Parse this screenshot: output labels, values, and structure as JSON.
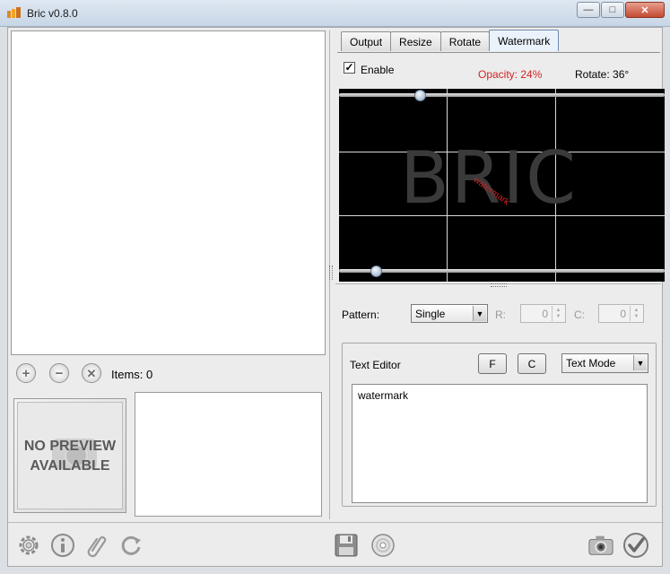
{
  "window": {
    "title": "Bric v0.8.0",
    "minimize_glyph": "—",
    "maximize_glyph": "□",
    "close_glyph": "✕"
  },
  "left": {
    "items_label": "Items: 0",
    "add_icon": "plus-circle-icon",
    "remove_icon": "minus-circle-icon",
    "clear_icon": "x-circle-icon",
    "preview_placeholder_line1": "NO PREVIEW",
    "preview_placeholder_line2": "AVAILABLE"
  },
  "tabs": [
    {
      "label": "Output",
      "active": false
    },
    {
      "label": "Resize",
      "active": false
    },
    {
      "label": "Rotate",
      "active": false
    },
    {
      "label": "Watermark",
      "active": true
    }
  ],
  "watermark": {
    "enable_label": "Enable",
    "enable_checked": true,
    "opacity_label": "Opacity: 24%",
    "opacity_percent": 24,
    "rotate_label": "Rotate: 36°",
    "rotate_degrees": 36,
    "preview_text_large": "BRIC",
    "preview_text_watermark": "watermark",
    "pattern_label": "Pattern:",
    "pattern_value": "Single",
    "rows_label": "R:",
    "rows_value": "0",
    "cols_label": "C:",
    "cols_value": "0",
    "text_editor_label": "Text Editor",
    "font_button": "F",
    "color_button": "C",
    "mode_value": "Text Mode",
    "text_value": "watermark"
  },
  "colors": {
    "opacity_text": "#d12424",
    "watermark_text": "#cc2222",
    "preview_bg": "#000000"
  }
}
